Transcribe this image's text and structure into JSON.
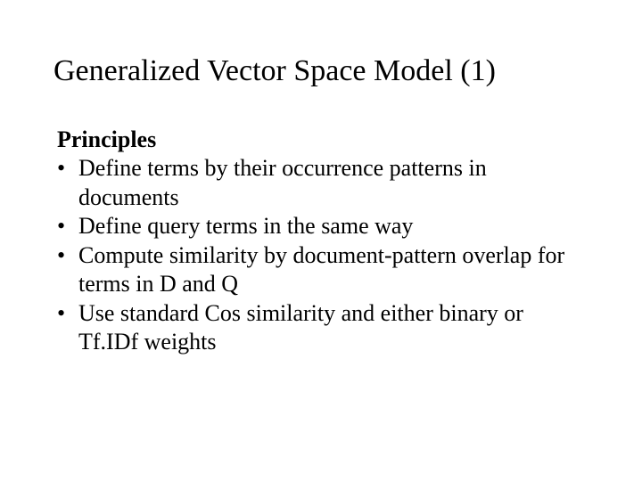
{
  "slide": {
    "title": "Generalized Vector Space Model (1)",
    "subhead": "Principles",
    "bullets": [
      "Define terms by their occurrence patterns in documents",
      "Define query terms in the same way",
      "Compute similarity by document-pattern overlap for terms in D and Q",
      "Use standard Cos similarity and either binary or Tf.IDf weights"
    ]
  }
}
